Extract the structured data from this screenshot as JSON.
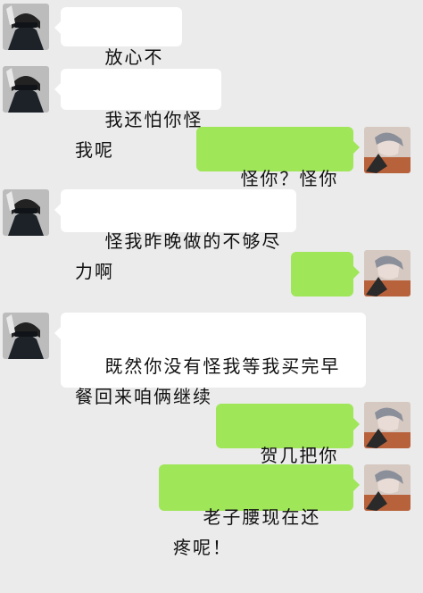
{
  "chat": {
    "messages": [
      {
        "side": "left",
        "text": "放心不会的"
      },
      {
        "side": "left",
        "text": "我还怕你怪我呢"
      },
      {
        "side": "right",
        "text": "怪你？怪你什么"
      },
      {
        "side": "left",
        "text": "怪我昨晚做的不够尽力啊"
      },
      {
        "side": "right",
        "text": "……"
      },
      {
        "side": "left",
        "text": "既然你没有怪我等我买完早餐回来咱俩继续"
      },
      {
        "side": "right",
        "text": "贺几把你敢！"
      },
      {
        "side": "right",
        "text": "老子腰现在还疼呢！"
      }
    ]
  },
  "avatars": {
    "contact": "contact-avatar",
    "self": "self-avatar"
  },
  "colors": {
    "background": "#ebebeb",
    "incoming_bubble": "#ffffff",
    "outgoing_bubble": "#9fe659"
  }
}
